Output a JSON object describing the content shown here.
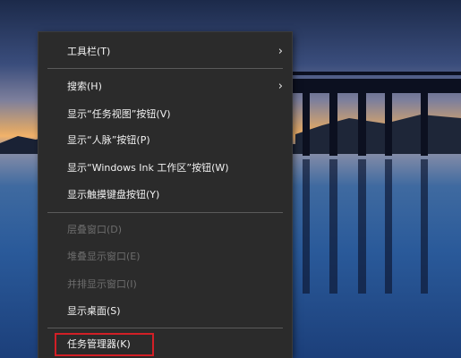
{
  "context_menu": {
    "items": [
      {
        "label": "工具栏(T)",
        "submenu": true,
        "enabled": true
      },
      {
        "label": "搜索(H)",
        "submenu": true,
        "enabled": true
      },
      {
        "label": "显示“任务视图”按钮(V)",
        "enabled": true
      },
      {
        "label": "显示“人脉”按钮(P)",
        "enabled": true
      },
      {
        "label": "显示“Windows Ink 工作区”按钮(W)",
        "enabled": true
      },
      {
        "label": "显示触摸键盘按钮(Y)",
        "enabled": true
      },
      {
        "label": "层叠窗口(D)",
        "enabled": false
      },
      {
        "label": "堆叠显示窗口(E)",
        "enabled": false
      },
      {
        "label": "并排显示窗口(I)",
        "enabled": false
      },
      {
        "label": "显示桌面(S)",
        "enabled": true
      },
      {
        "label": "任务管理器(K)",
        "enabled": true,
        "highlighted": true
      }
    ]
  },
  "icons": {
    "submenu_arrow": "chevron-right-icon"
  },
  "colors": {
    "menu_bg": "#2b2b2b",
    "text": "#f2f2f2",
    "disabled_text": "#6d6d6d",
    "highlight_border": "#d21f26"
  }
}
